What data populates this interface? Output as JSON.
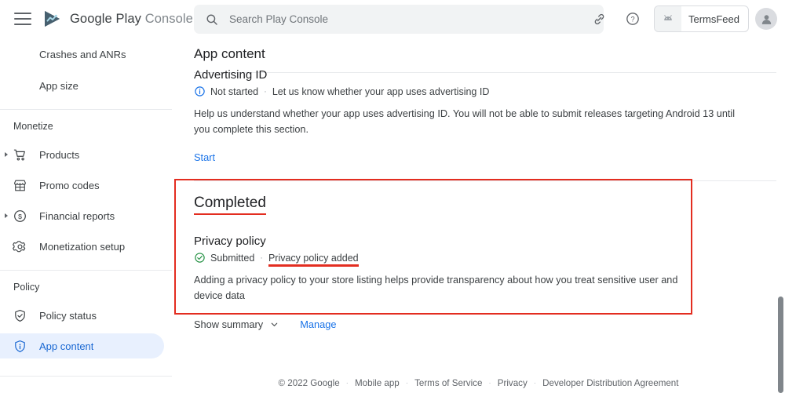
{
  "app": {
    "brand_primary": "Google Play",
    "brand_secondary": "Console",
    "menu_icon": "hamburger-icon",
    "logo_icon": "google-play-logo-icon"
  },
  "search": {
    "placeholder": "Search Play Console",
    "value": "",
    "icon": "search-icon"
  },
  "top_actions": {
    "link_icon": "link-icon",
    "help_icon": "help-circle-icon",
    "app_chip_icon": "android-robot-icon",
    "app_chip_label": "TermsFeed",
    "avatar_icon": "account-avatar-icon"
  },
  "sidebar": {
    "items_top": [
      {
        "label": "Crashes and ANRs",
        "icon": "",
        "expandable": false,
        "active": false
      },
      {
        "label": "App size",
        "icon": "",
        "expandable": false,
        "active": false
      }
    ],
    "group_monetize": "Monetize",
    "items_monetize": [
      {
        "label": "Products",
        "icon": "shopping-cart-icon",
        "expandable": true,
        "active": false
      },
      {
        "label": "Promo codes",
        "icon": "storefront-icon",
        "expandable": false,
        "active": false
      },
      {
        "label": "Financial reports",
        "icon": "dollar-circle-icon",
        "expandable": true,
        "active": false
      },
      {
        "label": "Monetization setup",
        "icon": "gear-icon",
        "expandable": false,
        "active": false
      }
    ],
    "group_policy": "Policy",
    "items_policy": [
      {
        "label": "Policy status",
        "icon": "shield-check-icon",
        "expandable": false,
        "active": false
      },
      {
        "label": "App content",
        "icon": "shield-info-icon",
        "expandable": false,
        "active": true
      }
    ]
  },
  "main": {
    "page_title": "App content",
    "advertising_id": {
      "title": "Advertising ID",
      "status_icon": "info-circle-icon",
      "status": "Not started",
      "separator": "·",
      "status_detail": "Let us know whether your app uses advertising ID",
      "description": "Help us understand whether your app uses advertising ID. You will not be able to submit releases targeting Android 13 until you complete this section.",
      "action_label": "Start"
    },
    "completed": {
      "heading": "Completed",
      "privacy_policy": {
        "title": "Privacy policy",
        "status_icon": "check-circle-icon",
        "status": "Submitted",
        "separator": "·",
        "status_detail": "Privacy policy added",
        "description": "Adding a privacy policy to your store listing helps provide transparency about how you treat sensitive user and device data",
        "show_summary_label": "Show summary",
        "chevron_icon": "chevron-down-icon",
        "manage_label": "Manage"
      }
    }
  },
  "footer": {
    "copyright": "© 2022 Google",
    "links": [
      "Mobile app",
      "Terms of Service",
      "Privacy",
      "Developer Distribution Agreement"
    ],
    "separator": "·"
  },
  "annotations": {
    "highlight_color": "#e32d20",
    "box_label": "completed-section-highlight",
    "underline_heading": "Completed",
    "underline_detail": "Privacy policy added"
  },
  "colors": {
    "accent_blue": "#1a73e8",
    "active_pill": "#e8f0fe",
    "status_green": "#1e8e3e",
    "text_primary": "#202124",
    "text_secondary": "#5f6368"
  }
}
